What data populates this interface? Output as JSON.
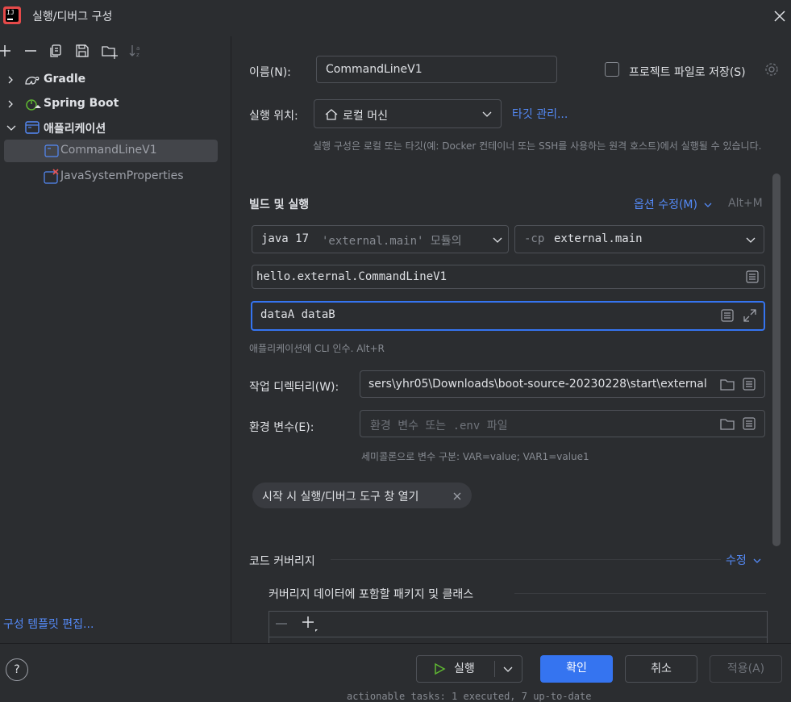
{
  "window": {
    "title": "실행/디버그 구성",
    "app_icon_text": "IJ"
  },
  "toolbar": {
    "icons": [
      "add-icon",
      "remove-icon",
      "copy-icon",
      "save-icon",
      "new-folder-icon",
      "sort-icon"
    ]
  },
  "tree": {
    "items": [
      {
        "label": "Gradle",
        "icon": "gradle-icon"
      },
      {
        "label": "Spring Boot",
        "icon": "spring-boot-icon"
      },
      {
        "label": "애플리케이션",
        "icon": "application-icon"
      },
      {
        "label": "CommandLineV1",
        "icon": "application-config-icon"
      },
      {
        "label": "JavaSystemProperties",
        "icon": "application-config-error-icon"
      }
    ],
    "edit_templates": "구성 템플릿 편집..."
  },
  "form": {
    "name_label": "이름(N):",
    "name_value": "CommandLineV1",
    "store_as_project_file": "프로젝트 파일로 저장(S)",
    "run_on_label": "실행 위치:",
    "run_on_value": "로컬 머신",
    "manage_targets": "타깃 관리...",
    "run_on_hint": "실행 구성은 로컬 또는 타깃(예: Docker 컨테이너 또는 SSH를 사용하는 원격 호스트)에서 실행될 수 있습니다.",
    "build_run_title": "빌드 및 실행",
    "modify_options": "옵션 수정(M)",
    "modify_options_shortcut": "Alt+M",
    "jdk_value": "java 17",
    "jdk_module_hint": "'external.main' 모듈의",
    "cp_prefix": "-cp",
    "cp_value": "external.main",
    "main_class": "hello.external.CommandLineV1",
    "program_args": "dataA dataB",
    "program_args_hint": "애플리케이션에 CLI 인수. Alt+R",
    "workdir_label": "작업 디렉터리(W):",
    "workdir_value": "sers\\yhr05\\Downloads\\boot-source-20230228\\start\\external",
    "env_label": "환경 변수(E):",
    "env_placeholder": "환경 변수 또는 .env 파일",
    "env_hint": "세미콜론으로 변수 구분: VAR=value; VAR1=value1",
    "open_tool_window_chip": "시작 시 실행/디버그 도구 창 열기",
    "coverage_title": "코드 커버리지",
    "coverage_modify": "수정",
    "coverage_subtitle": "커버리지 데이터에 포함할 패키지 및 클래스"
  },
  "buttons": {
    "run": "실행",
    "ok": "확인",
    "cancel": "취소",
    "apply": "적용(A)",
    "help": "?"
  },
  "bottom_terminal_text": "actionable tasks: 1 executed, 7 up-to-date",
  "colors": {
    "accent": "#3574f0",
    "link": "#548af7",
    "background": "#2b2d30",
    "focus_border": "#3574f0"
  }
}
